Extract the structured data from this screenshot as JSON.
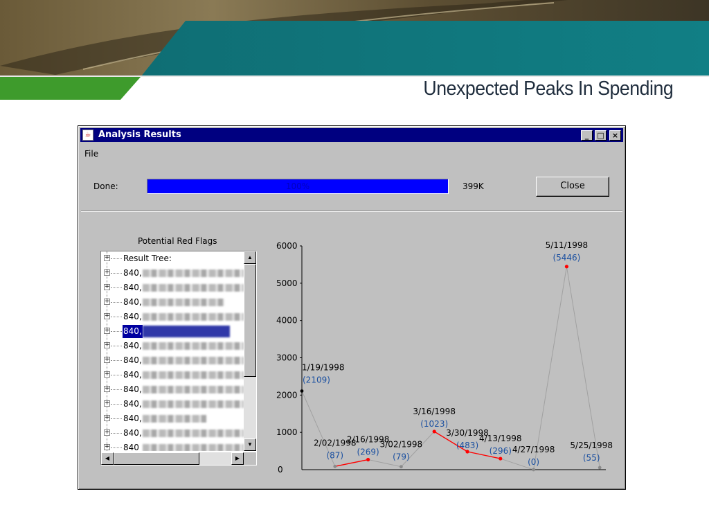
{
  "slide": {
    "title": "Unexpected Peaks In Spending"
  },
  "window": {
    "title": "Analysis Results",
    "menu": [
      "File"
    ],
    "controls": {
      "minimize": "_",
      "maximize": "□",
      "close": "×"
    }
  },
  "status": {
    "done_label": "Done:",
    "progress_percent": 100,
    "progress_text": "100%",
    "size": "399K",
    "close_label": "Close"
  },
  "tree": {
    "group_label": "Potential Red Flags",
    "root_label": "Result Tree:",
    "items": [
      "840,",
      "840,",
      "840,",
      "840,",
      "840,",
      "840,",
      "840,",
      "840,",
      "840,",
      "840,",
      "840,",
      "840,",
      "840"
    ],
    "selected_index": 4,
    "blur_widths": [
      168,
      172,
      118,
      168,
      126,
      170,
      164,
      172,
      152,
      172,
      92,
      168,
      160,
      150
    ]
  },
  "colors": {
    "titlebar": "#000080",
    "progress": "#0000ff",
    "window_bg": "#c0c0c0",
    "red_line": "#ff0000",
    "gray_line": "#a0a0a0",
    "value_label": "#1a4fa0",
    "banner_teal": "#117a80",
    "banner_green": "#3e9b2c"
  },
  "icons": {
    "app": "coffee-cup-icon",
    "expander": "plus-box-icon",
    "scroll_up": "▲",
    "scroll_down": "▼",
    "scroll_left": "◀",
    "scroll_right": "▶"
  },
  "chart_data": {
    "type": "line",
    "ylim": [
      0,
      6000
    ],
    "yticks": [
      0,
      1000,
      2000,
      3000,
      4000,
      5000,
      6000
    ],
    "x": [
      "1/19/1998",
      "2/02/1998",
      "2/16/1998",
      "3/02/1998",
      "3/16/1998",
      "3/30/1998",
      "4/13/1998",
      "4/27/1998",
      "5/11/1998",
      "5/25/1998"
    ],
    "values": [
      2109,
      87,
      269,
      79,
      1023,
      483,
      296,
      0,
      5446,
      55
    ],
    "value_labels": [
      "(2109)",
      "(87)",
      "(269)",
      "(79)",
      "(1023)",
      "(483)",
      "(296)",
      "(0)",
      "(5446)",
      "(55)"
    ],
    "highlight_segments": [
      [
        1,
        2
      ],
      [
        4,
        5
      ],
      [
        5,
        6
      ]
    ],
    "highlight_points": [
      2,
      4,
      5,
      6,
      8
    ]
  }
}
